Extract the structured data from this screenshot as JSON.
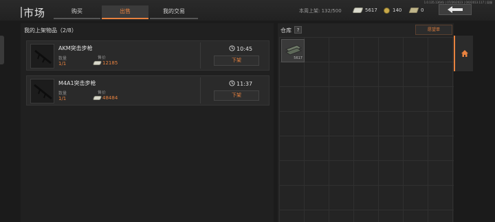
{
  "header": {
    "title": "市场",
    "tabs": [
      {
        "label": "购买",
        "active": false
      },
      {
        "label": "出售",
        "active": true
      },
      {
        "label": "我的交易",
        "active": false
      }
    ],
    "weekly_listing_label": "本周上架: 132/500",
    "currencies": [
      {
        "icon": "money-icon",
        "value": "5617"
      },
      {
        "icon": "coin-icon",
        "value": "140"
      },
      {
        "icon": "bond-icon",
        "value": "0"
      }
    ],
    "version_text": "1.0.135.136(6) | 07/26/2023 | 0/0/2013.117 | 局服"
  },
  "listings_panel": {
    "header": "我的上架物品（2/8）",
    "items": [
      {
        "name": "AKM突击步枪",
        "qty_label": "数量",
        "qty": "1/1",
        "price_label": "售价",
        "price": "12185",
        "timer": "10:45",
        "action": "下架"
      },
      {
        "name": "M4A1突击步枪",
        "qty_label": "数量",
        "qty": "1/1",
        "price_label": "售价",
        "price": "48484",
        "timer": "11:37",
        "action": "下架"
      }
    ]
  },
  "warehouse": {
    "label": "仓库",
    "help": "?",
    "wishlist_button": "愿望单",
    "item_count": "5617"
  },
  "colors": {
    "accent": "#e8823f",
    "background": "#1b1b1b",
    "panel": "#202020"
  }
}
